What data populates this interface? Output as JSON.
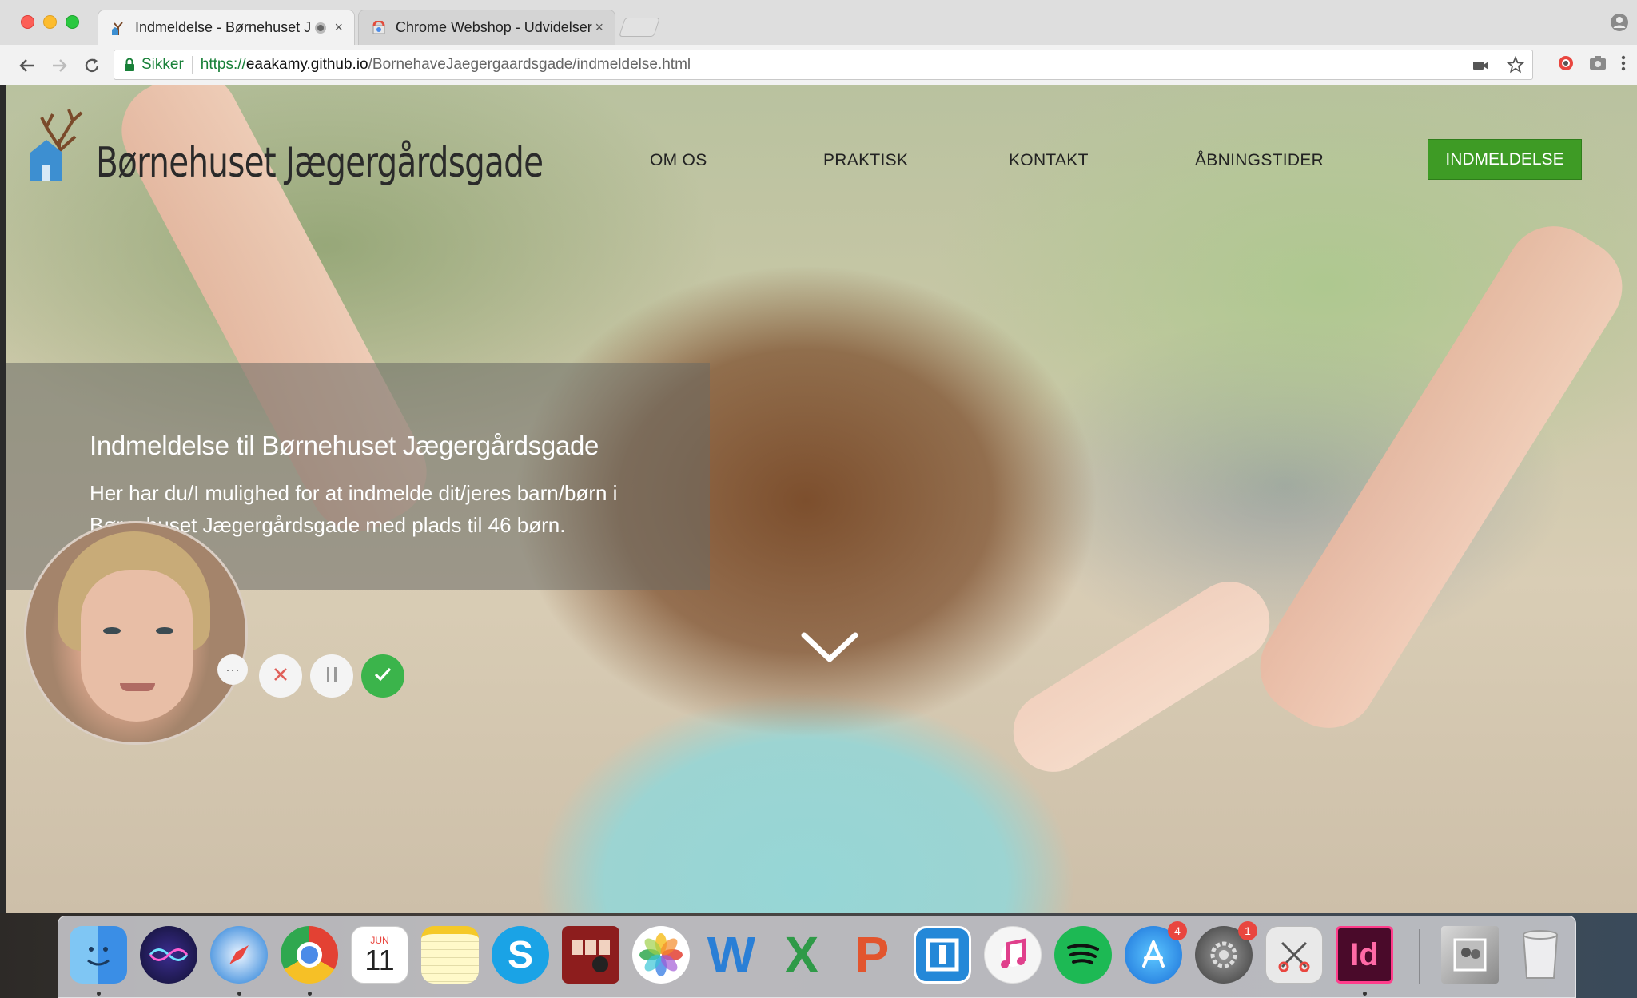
{
  "browser": {
    "tabs": [
      {
        "title": "Indmeldelse - Børnehuset J",
        "close": "×"
      },
      {
        "title": "Chrome Webshop - Udvidelser",
        "close": "×"
      }
    ],
    "security_label": "Sikker",
    "url": {
      "scheme": "https://",
      "host": "eaakamy.github.io",
      "path": "/BornehaveJaegergaardsgade/indmeldelse.html"
    }
  },
  "site": {
    "logo_text": "Børnehuset Jægergårdsgade",
    "nav": [
      "OM OS",
      "PRAKTISK",
      "KONTAKT",
      "ÅBNINGSTIDER"
    ],
    "nav_cta": "INDMELDELSE",
    "hero_title": "Indmeldelse til Børnehuset Jægergårdsgade",
    "hero_text": "Her har du/I mulighed for at indmelde dit/jeres barn/børn i Børnehuset Jægergårdsgade med plads til 46 børn."
  },
  "recorder": {
    "more_label": "···"
  },
  "dock": {
    "calendar_month": "JUN",
    "calendar_day": "11",
    "appstore_badge": "4",
    "prefs_badge": "1",
    "word_letter": "W",
    "excel_letter": "X",
    "ppt_letter": "P",
    "indesign_label": "Id"
  },
  "colors": {
    "accent_green": "#3e9b25",
    "secure_green": "#188038"
  }
}
